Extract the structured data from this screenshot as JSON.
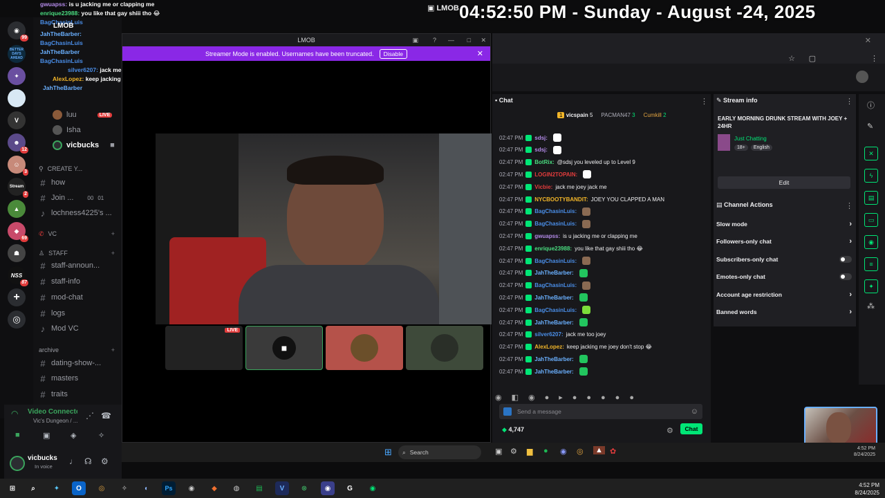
{
  "clock": "04:52:50 PM - Sunday - August -24, 2025",
  "overlay_window_title": "LMOB",
  "overlay_chat": [
    {
      "user": "gwuapss:",
      "text": "is u jacking me or clapping me",
      "color": "#b38ae8"
    },
    {
      "user": "enrique23988:",
      "text": "you like that gay shiii tho 😂",
      "color": "#4ade80"
    },
    {
      "user": "BagChasinLuis",
      "text": "",
      "color": "#4a8ee8"
    },
    {
      "user": "JahTheBarber:",
      "text": "",
      "color": "#6ab0ff"
    },
    {
      "user": "BagChasinLuis",
      "text": "",
      "color": "#4a8ee8"
    },
    {
      "user": "JahTheBarber",
      "text": "",
      "color": "#6ab0ff"
    },
    {
      "user": "BagChasinLuis",
      "text": "",
      "color": "#4a8ee8"
    },
    {
      "user": "JahTheBarber",
      "text": "",
      "color": "#6ab0ff"
    },
    {
      "user": "silver6207:",
      "text": "jack me too joey",
      "color": "#4a8ee8"
    },
    {
      "user": "AlexLopez:",
      "text": "keep jacking me joey don't stop 😂",
      "color": "#f0b429"
    },
    {
      "user": "JahTheBarber",
      "text": "",
      "color": "#6ab0ff"
    }
  ],
  "discord": {
    "server_header": "LMOB",
    "channels": [
      {
        "kind": "voice-user",
        "label": "luu",
        "badge": "LIVE"
      },
      {
        "kind": "voice-user",
        "label": "Isha",
        "badge": ""
      },
      {
        "kind": "voice-user",
        "label": "vicbucks",
        "badge": ""
      },
      {
        "kind": "category",
        "label": "CREATE Y..."
      },
      {
        "kind": "text",
        "label": "how"
      },
      {
        "kind": "text",
        "label": "Join ..."
      },
      {
        "kind": "voice",
        "label": "lochness4225's ..."
      },
      {
        "kind": "category",
        "label": "VC"
      },
      {
        "kind": "category",
        "label": "STAFF"
      },
      {
        "kind": "text",
        "label": "staff-announ..."
      },
      {
        "kind": "text",
        "label": "staff-info"
      },
      {
        "kind": "text",
        "label": "mod-chat"
      },
      {
        "kind": "text",
        "label": "logs"
      },
      {
        "kind": "voice",
        "label": "Mod VC"
      },
      {
        "kind": "category",
        "label": "archive"
      },
      {
        "kind": "text",
        "label": "dating-show-..."
      },
      {
        "kind": "text",
        "label": "masters"
      },
      {
        "kind": "text",
        "label": "traits"
      }
    ],
    "counts": {
      "join_a": "00",
      "join_b": "01",
      "mid_a": "00",
      "mid_b": "99"
    },
    "voice_panel": {
      "status": "Video Connecte",
      "location": "Vic's Dungeon / ...",
      "username": "vicbucks",
      "user_status": "In voice"
    },
    "server_badges": [
      "99",
      "12",
      "3",
      "2",
      "69",
      "87"
    ],
    "server_labels": [
      "BETTER DAYS AHEAD",
      "Stream",
      "NSS"
    ]
  },
  "popup": {
    "title": "LMOB",
    "banner_text": "Streamer Mode is enabled. Usernames have been truncated.",
    "banner_button": "Disable",
    "live_badge": "LIVE"
  },
  "twitch": {
    "panel_title": "Chat",
    "leaderboard": [
      {
        "rank": "1",
        "name": "vicspain",
        "count": "5"
      },
      {
        "rank": "",
        "name": "PACMAN47",
        "count": "3"
      },
      {
        "rank": "",
        "name": "Cumkill",
        "count": "2"
      }
    ],
    "messages": [
      {
        "ts": "02:47 PM",
        "user": "sdsj:",
        "text": "",
        "color": "#b38ae8",
        "emote": "#ffffff"
      },
      {
        "ts": "02:47 PM",
        "user": "sdsj:",
        "text": "",
        "color": "#b38ae8",
        "emote": "#ffffff"
      },
      {
        "ts": "02:47 PM",
        "user": "BotRix:",
        "text": "@sdsj you leveled up to Level 9",
        "color": "#4ade80",
        "emote": ""
      },
      {
        "ts": "02:47 PM",
        "user": "LOGIN2TOPAIN:",
        "text": "",
        "color": "#e23c3c",
        "emote": "#ffffff"
      },
      {
        "ts": "02:47 PM",
        "user": "Vicbie:",
        "text": "jack me joey jack me",
        "color": "#e23c3c",
        "emote": ""
      },
      {
        "ts": "02:47 PM",
        "user": "NYCBOOTYBANDIT:",
        "text": "JOEY YOU CLAPPED A MAN",
        "color": "#f0b429",
        "emote": ""
      },
      {
        "ts": "02:47 PM",
        "user": "BagChasinLuis:",
        "text": "",
        "color": "#4a8ee8",
        "emote": "#8a6a52"
      },
      {
        "ts": "02:47 PM",
        "user": "BagChasinLuis:",
        "text": "",
        "color": "#4a8ee8",
        "emote": "#8a6a52"
      },
      {
        "ts": "02:47 PM",
        "user": "gwuapss:",
        "text": "is u jacking me or clapping me",
        "color": "#b38ae8",
        "emote": ""
      },
      {
        "ts": "02:47 PM",
        "user": "enrique23988:",
        "text": "you like that gay shiii tho 😂",
        "color": "#4ade80",
        "emote": ""
      },
      {
        "ts": "02:47 PM",
        "user": "BagChasinLuis:",
        "text": "",
        "color": "#4a8ee8",
        "emote": "#8a6a52"
      },
      {
        "ts": "02:47 PM",
        "user": "JahTheBarber:",
        "text": "",
        "color": "#6ab0ff",
        "emote": "#22c55e"
      },
      {
        "ts": "02:47 PM",
        "user": "BagChasinLuis:",
        "text": "",
        "color": "#4a8ee8",
        "emote": "#8a6a52"
      },
      {
        "ts": "02:47 PM",
        "user": "JahTheBarber:",
        "text": "",
        "color": "#6ab0ff",
        "emote": "#22c55e"
      },
      {
        "ts": "02:47 PM",
        "user": "BagChasinLuis:",
        "text": "",
        "color": "#4a8ee8",
        "emote": "#7cdd3a"
      },
      {
        "ts": "02:47 PM",
        "user": "JahTheBarber:",
        "text": "",
        "color": "#6ab0ff",
        "emote": "#22c55e"
      },
      {
        "ts": "02:47 PM",
        "user": "silver6207:",
        "text": "jack me too joey",
        "color": "#4a8ee8",
        "emote": ""
      },
      {
        "ts": "02:47 PM",
        "user": "AlexLopez:",
        "text": "keep jacking me joey don't stop 😂",
        "color": "#f0b429",
        "emote": ""
      },
      {
        "ts": "02:47 PM",
        "user": "JahTheBarber:",
        "text": "",
        "color": "#6ab0ff",
        "emote": "#22c55e"
      },
      {
        "ts": "02:47 PM",
        "user": "JahTheBarber:",
        "text": "",
        "color": "#6ab0ff",
        "emote": "#22c55e"
      }
    ],
    "input_placeholder": "Send a message",
    "points": "4,747",
    "chat_button": "Chat",
    "stream_info": {
      "header": "Stream info",
      "title": "EARLY MORNING DRUNK STREAM WITH JOEY + 24HR",
      "category": "Just Chatting",
      "tags": [
        "18+",
        "English"
      ],
      "edit_button": "Edit"
    },
    "channel_actions": {
      "header": "Channel Actions",
      "items": [
        {
          "label": "Slow mode",
          "control": "arrow"
        },
        {
          "label": "Followers-only chat",
          "control": "arrow"
        },
        {
          "label": "Subscribers-only chat",
          "control": "toggle"
        },
        {
          "label": "Emotes-only chat",
          "control": "toggle"
        },
        {
          "label": "Account age restriction",
          "control": "arrow"
        },
        {
          "label": "Banned words",
          "control": "arrow"
        }
      ]
    }
  },
  "inner_taskbar": {
    "search": "Search",
    "time": "4:52 PM",
    "date": "8/24/2025"
  },
  "taskbar": {
    "time": "4:52 PM",
    "date": "8/24/2025"
  },
  "colors": {
    "twitch_green": "#00e676",
    "banner_purple": "#8a28e6",
    "live_red": "#e23c3c"
  }
}
